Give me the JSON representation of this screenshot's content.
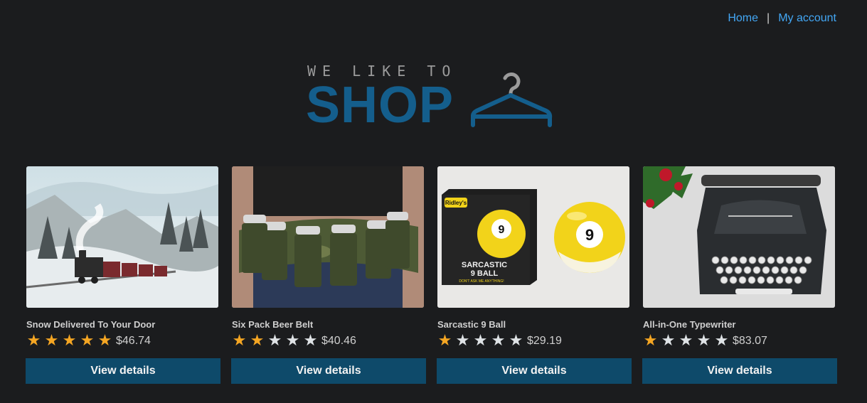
{
  "nav": {
    "home": "Home",
    "separator": "|",
    "account": "My account"
  },
  "logo": {
    "tagline": "WE LIKE TO",
    "word": "SHOP"
  },
  "products": [
    {
      "name": "Snow Delivered To Your Door",
      "rating": 5,
      "price": "$46.74",
      "button": "View details"
    },
    {
      "name": "Six Pack Beer Belt",
      "rating": 2,
      "price": "$40.46",
      "button": "View details"
    },
    {
      "name": "Sarcastic 9 Ball",
      "rating": 1,
      "price": "$29.19",
      "button": "View details",
      "image_text": {
        "brand": "Ridley's",
        "title_line1": "SARCASTIC",
        "title_line2": "9 BALL",
        "tag": "DON'T ASK ME ANYTHING!",
        "ball_number": "9"
      }
    },
    {
      "name": "All-in-One Typewriter",
      "rating": 1,
      "price": "$83.07",
      "button": "View details"
    }
  ],
  "colors": {
    "star_on": "#f5a623",
    "star_off": "#dfe3e6",
    "button_bg": "#0e4a6a",
    "link": "#43a7f5",
    "logo_blue": "#145e8c"
  }
}
